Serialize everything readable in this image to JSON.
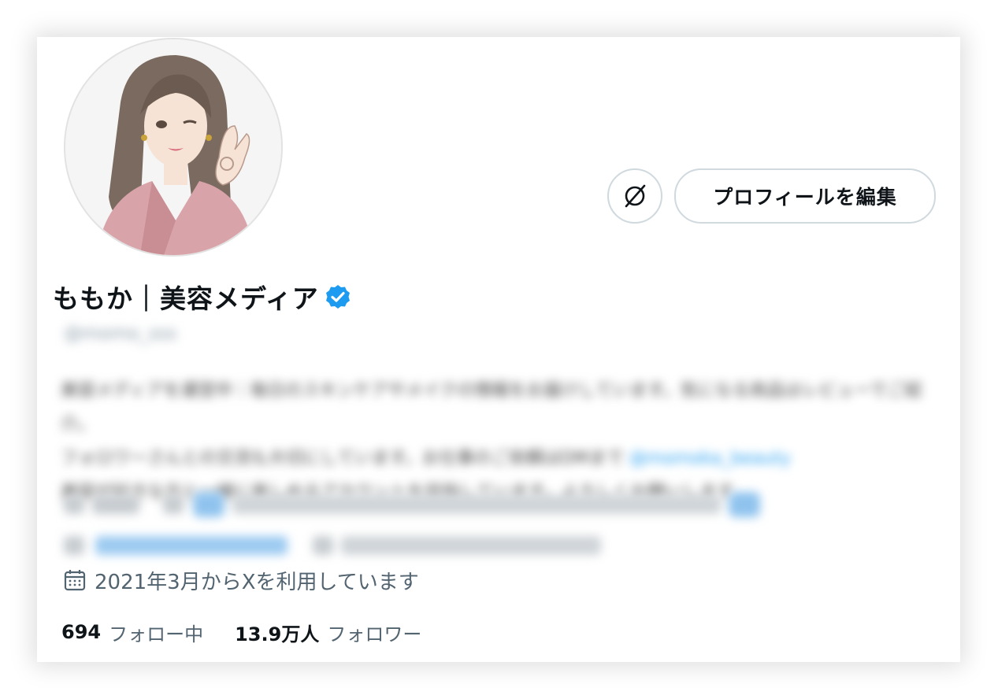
{
  "profile": {
    "display_name": "ももか｜美容メディア",
    "verified": true,
    "handle": "@momo_sss",
    "bio_line1": "美容メディアを運営中｜毎日のスキンケアやメイクの情報をお届けしています。気になる商品はレビューでご紹介。",
    "bio_line2": "フォロワーさんとの交流も大切にしています。お仕事のご依頼はDMまで",
    "bio_link": "@momoka_beauty",
    "bio_line3": "美容が好きな方と一緒に楽しめるアカウントを目指しています。よろしくお願いします"
  },
  "buttons": {
    "edit_profile": "プロフィールを編集"
  },
  "joined_text": "2021年3月からXを利用しています",
  "stats": {
    "following_count": "694",
    "following_label": "フォロー中",
    "followers_count": "13.9万人",
    "followers_label": "フォロワー"
  },
  "colors": {
    "accent": "#1d9bf0",
    "text_primary": "#0f1419",
    "text_secondary": "#536471",
    "border": "#cfd9de"
  },
  "icons": {
    "verified": "verified-badge-icon",
    "settings": "no-symbol-icon",
    "calendar": "calendar-icon"
  }
}
